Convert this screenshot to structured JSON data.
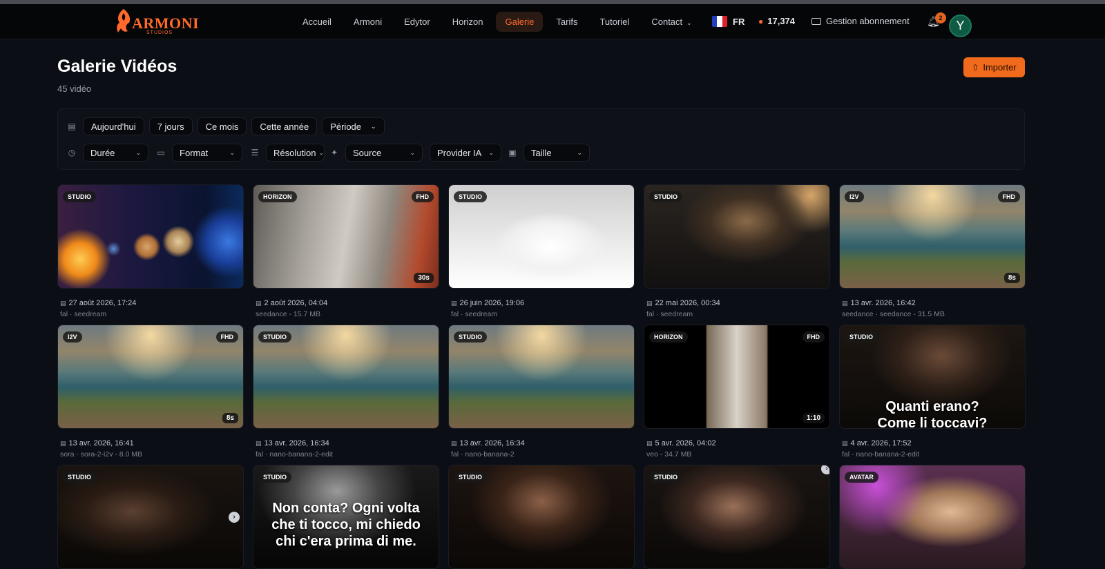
{
  "brand": {
    "name": "ARMONI",
    "sub": "STUDIOS"
  },
  "nav": {
    "links": [
      "Accueil",
      "Armoni",
      "Edytor",
      "Horizon",
      "Galerie",
      "Tarifs",
      "Tutoriel",
      "Contact"
    ],
    "active": "Galerie",
    "lang": "FR",
    "credits": "17,374",
    "subscription": "Gestion abonnement",
    "notifications": "2",
    "avatar_initial": "Y"
  },
  "page": {
    "title": "Galerie Vidéos",
    "count": "45 vidéo",
    "import_label": "Importer"
  },
  "filters": {
    "date_chips": [
      "Aujourd'hui",
      "7 jours",
      "Ce mois",
      "Cette année"
    ],
    "period": "Période",
    "duration": "Durée",
    "format": "Format",
    "resolution": "Résolution",
    "source": "Source",
    "provider": "Provider IA",
    "size": "Taille"
  },
  "videos": [
    {
      "badge": "STUDIO",
      "quality": "",
      "duration": "",
      "date": "27 août 2026, 17:24",
      "source": "fal · seedream",
      "scene": "planets"
    },
    {
      "badge": "HORIZON",
      "quality": "FHD",
      "duration": "30s",
      "date": "2 août 2026, 04:04",
      "source": "seedance  -  15.7 MB",
      "scene": "warehouse"
    },
    {
      "badge": "STUDIO",
      "quality": "",
      "duration": "",
      "date": "26 juin 2026, 19:06",
      "source": "fal · seedream",
      "scene": "sneaker"
    },
    {
      "badge": "STUDIO",
      "quality": "",
      "duration": "",
      "date": "22 mai 2026, 00:34",
      "source": "fal · seedream",
      "scene": "knight"
    },
    {
      "badge": "I2V",
      "quality": "FHD",
      "duration": "8s",
      "date": "13 avr. 2026, 16:42",
      "source": "seedance · seedance  -  31.5 MB",
      "scene": "coast"
    },
    {
      "badge": "I2V",
      "quality": "FHD",
      "duration": "8s",
      "date": "13 avr. 2026, 16:41",
      "source": "sora · sora-2-i2v  -  8.0 MB",
      "scene": "coast"
    },
    {
      "badge": "STUDIO",
      "quality": "",
      "duration": "",
      "date": "13 avr. 2026, 16:34",
      "source": "fal · nano-banana-2-edit",
      "scene": "coast"
    },
    {
      "badge": "STUDIO",
      "quality": "",
      "duration": "",
      "date": "13 avr. 2026, 16:34",
      "source": "fal · nano-banana-2",
      "scene": "coast"
    },
    {
      "badge": "HORIZON",
      "quality": "FHD",
      "duration": "1:10",
      "date": "5 avr. 2026, 04:02",
      "source": "veo  -  34.7 MB",
      "scene": "hallway"
    },
    {
      "badge": "STUDIO",
      "quality": "",
      "duration": "",
      "date": "4 avr. 2026, 17:52",
      "source": "fal · nano-banana-2-edit",
      "scene": "hoodie",
      "overlay": "Quanti erano?\nCome li toccavi?"
    },
    {
      "badge": "STUDIO",
      "quality": "",
      "duration": "",
      "date": "",
      "source": "",
      "scene": "man-dark"
    },
    {
      "badge": "STUDIO",
      "quality": "",
      "duration": "",
      "date": "",
      "source": "",
      "scene": "bw-man",
      "overlay": "Non conta? Ogni volta\nche ti tocco, mi chiedo\nchi c'era prima di me."
    },
    {
      "badge": "STUDIO",
      "quality": "",
      "duration": "",
      "date": "",
      "source": "",
      "scene": "woman-hood"
    },
    {
      "badge": "STUDIO",
      "quality": "",
      "duration": "",
      "date": "",
      "source": "",
      "scene": "woman-portrait"
    },
    {
      "badge": "AVATAR",
      "quality": "",
      "duration": "",
      "date": "",
      "source": "",
      "scene": "podcast"
    }
  ],
  "colors": {
    "accent": "#f26a1b",
    "background": "#0b0e14",
    "panel": "#0e1118"
  }
}
